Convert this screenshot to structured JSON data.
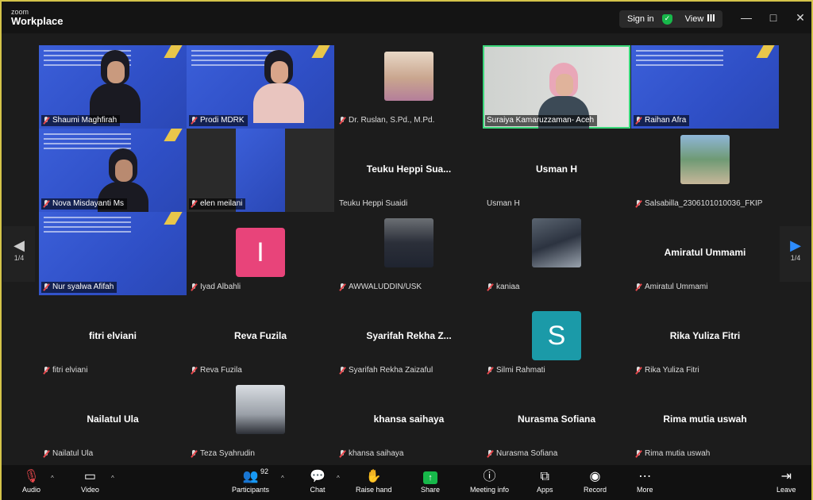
{
  "titlebar": {
    "logo_line1": "zoom",
    "logo_line2": "Workplace",
    "sign_in": "Sign in",
    "view": "View",
    "minimize": "—",
    "maximize": "□",
    "close": "✕"
  },
  "participants": [
    {
      "name": "Shaumi Maghfirah",
      "display": "",
      "kind": "slide"
    },
    {
      "name": "Prodi MDRK",
      "display": "",
      "kind": "slide"
    },
    {
      "name": "Dr. Ruslan, S.Pd., M.Pd.",
      "display": "",
      "kind": "photo"
    },
    {
      "name": "Suraiya Kamaruzzaman- Aceh",
      "display": "",
      "kind": "video"
    },
    {
      "name": "Raihan Afra",
      "display": "",
      "kind": "slide"
    },
    {
      "name": "Nova Misdayanti Ms",
      "display": "",
      "kind": "slide"
    },
    {
      "name": "elen meilani",
      "display": "",
      "kind": "slide"
    },
    {
      "name": "Teuku Heppi Suaidi",
      "display": "Teuku Heppi Sua...",
      "kind": "text"
    },
    {
      "name": "Usman H",
      "display": "Usman H",
      "kind": "text"
    },
    {
      "name": "Salsabilla_2306101010036_FKIP",
      "display": "",
      "kind": "photo"
    },
    {
      "name": "Nur syalwa Afifah",
      "display": "",
      "kind": "slide"
    },
    {
      "name": "Iyad Albahli",
      "display": "I",
      "kind": "letter"
    },
    {
      "name": "AWWALUDDIN/USK",
      "display": "",
      "kind": "photo"
    },
    {
      "name": "kaniaa",
      "display": "",
      "kind": "photo"
    },
    {
      "name": "Amiratul Ummami",
      "display": "Amiratul Ummami",
      "kind": "text"
    },
    {
      "name": "fitri elviani",
      "display": "fitri elviani",
      "kind": "text"
    },
    {
      "name": "Reva Fuzila",
      "display": "Reva Fuzila",
      "kind": "text"
    },
    {
      "name": "Syarifah Rekha Zaizaful",
      "display": "Syarifah  Rekha  Z...",
      "kind": "text"
    },
    {
      "name": "Silmi Rahmati",
      "display": "S",
      "kind": "letter"
    },
    {
      "name": "Rika Yuliza Fitri",
      "display": "Rika Yuliza Fitri",
      "kind": "text"
    },
    {
      "name": "Nailatul Ula",
      "display": "Nailatul Ula",
      "kind": "text"
    },
    {
      "name": "Teza Syahrudin",
      "display": "",
      "kind": "photo"
    },
    {
      "name": "khansa saihaya",
      "display": "khansa saihaya",
      "kind": "text"
    },
    {
      "name": "Nurasma Sofiana",
      "display": "Nurasma Sofiana",
      "kind": "text"
    },
    {
      "name": "Rima mutia uswah",
      "display": "Rima mutia uswah",
      "kind": "text"
    }
  ],
  "pager": {
    "left": "1/4",
    "right": "1/4"
  },
  "toolbar": {
    "audio": "Audio",
    "video": "Video",
    "participants": "Participants",
    "participants_count": "92",
    "chat": "Chat",
    "raise_hand": "Raise hand",
    "share": "Share",
    "meeting_info": "Meeting info",
    "apps": "Apps",
    "record": "Record",
    "more": "More",
    "leave": "Leave"
  },
  "colors": {
    "letter_I": "#e8447a",
    "letter_S": "#1b9aa8",
    "active_speaker": "#3ad77a",
    "share": "#17b84a"
  }
}
